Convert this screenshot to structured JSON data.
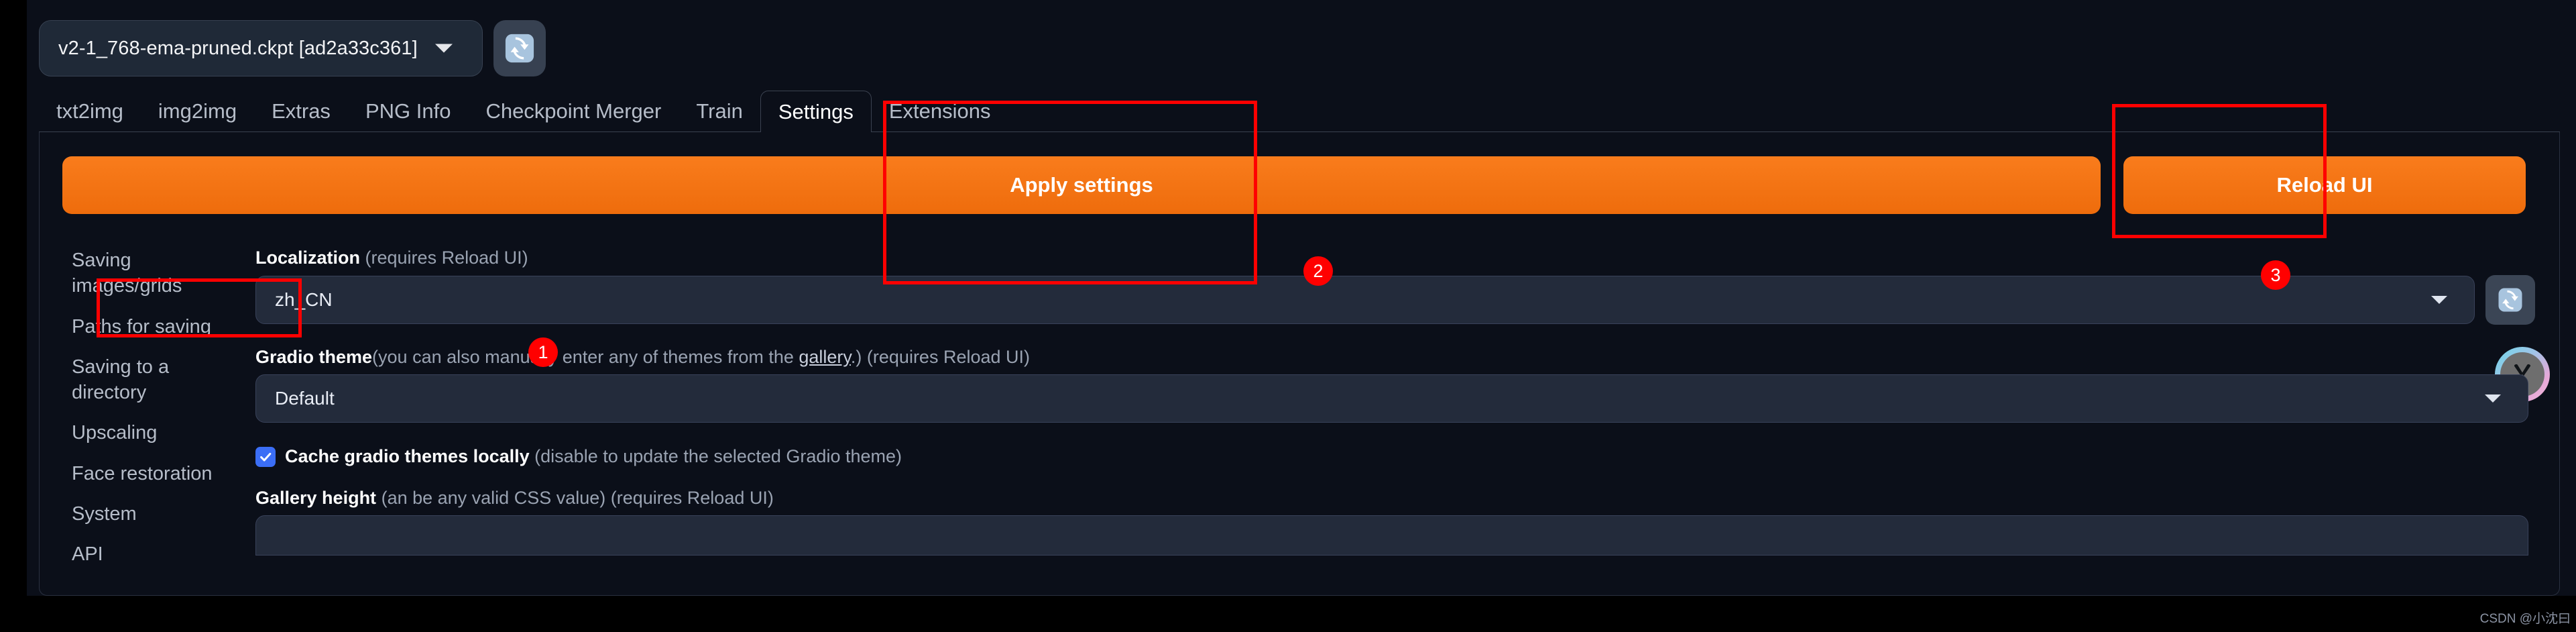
{
  "topbar": {
    "model_checkpoint": "v2-1_768-ema-pruned.ckpt [ad2a33c361]",
    "refresh_icon": "refresh-icon"
  },
  "tabs": [
    {
      "label": "txt2img",
      "active": false
    },
    {
      "label": "img2img",
      "active": false
    },
    {
      "label": "Extras",
      "active": false
    },
    {
      "label": "PNG Info",
      "active": false
    },
    {
      "label": "Checkpoint Merger",
      "active": false
    },
    {
      "label": "Train",
      "active": false
    },
    {
      "label": "Settings",
      "active": true
    },
    {
      "label": "Extensions",
      "active": false
    }
  ],
  "actions": {
    "apply_settings": "Apply settings",
    "reload_ui": "Reload UI"
  },
  "sidebar": {
    "items": [
      {
        "label": "Saving images/grids"
      },
      {
        "label": "Paths for saving"
      },
      {
        "label": "Saving to a directory"
      },
      {
        "label": "Upscaling"
      },
      {
        "label": "Face restoration"
      },
      {
        "label": "System"
      },
      {
        "label": "API"
      }
    ]
  },
  "settings": {
    "localization": {
      "label": "Localization",
      "hint": "(requires Reload UI)",
      "value": "zh_CN",
      "refresh_icon": "refresh-icon"
    },
    "gradio_theme": {
      "label": "Gradio theme",
      "hint_before": "(you can also manually enter any of themes from the ",
      "link": "gallery",
      "hint_after": ".) (requires Reload UI)",
      "value": "Default"
    },
    "cache_themes": {
      "label": "Cache gradio themes locally",
      "hint": "(disable to update the selected Gradio theme)",
      "checked": true
    },
    "gallery_height": {
      "label": "Gallery height",
      "hint": "(an be any valid CSS value) (requires Reload UI)",
      "value": ""
    }
  },
  "annotations": {
    "accent_color": "#ff0000",
    "badges": [
      {
        "number": "1"
      },
      {
        "number": "2"
      },
      {
        "number": "3"
      }
    ]
  },
  "watermark": "CSDN @小沈曰",
  "colors": {
    "background": "#0b0f19",
    "orange": "#f2740f",
    "checkbox_blue": "#3b6ef6",
    "annotation_red": "#ff0000"
  }
}
